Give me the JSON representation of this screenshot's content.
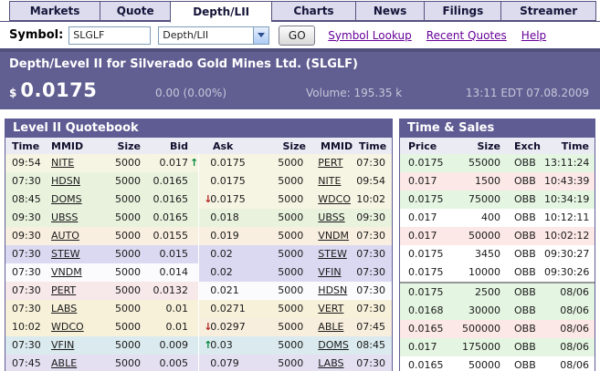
{
  "nav": {
    "tabs": [
      {
        "label": "Markets"
      },
      {
        "label": "Quote"
      },
      {
        "label": "Depth/LII"
      },
      {
        "label": "Charts"
      },
      {
        "label": "News"
      },
      {
        "label": "Filings"
      },
      {
        "label": "Streamer"
      }
    ],
    "active_tab": "Depth/LII"
  },
  "symbol_bar": {
    "label": "Symbol:",
    "symbol_value": "SLGLF",
    "view_selected": "Depth/LII",
    "go_label": "GO",
    "links": [
      {
        "label": "Symbol Lookup"
      },
      {
        "label": "Recent Quotes"
      },
      {
        "label": "Help"
      }
    ]
  },
  "quote_header": {
    "title": "Depth/Level II for Silverado Gold Mines Ltd.  (SLGLF)",
    "currency": "$",
    "price": "0.0175",
    "change": "0.00 (0.00%)",
    "volume": "Volume: 195.35 k",
    "timestamp": "13:11 EDT 07.08.2009"
  },
  "level2": {
    "title": "Level II Quotebook",
    "headers": [
      "Time",
      "MMID",
      "Size",
      "Bid",
      "Ask",
      "Size",
      "MMID",
      "Time"
    ],
    "rows": [
      {
        "bid_time": "09:54",
        "bid_mmid": "NITE",
        "bid_size": "5000",
        "bid": "0.017",
        "bid_arrow": "↑",
        "bid_arrow_color": "#00883c",
        "ask_arrow": "",
        "ask": "0.0175",
        "ask_size": "5000",
        "ask_mmid": "PERT",
        "ask_time": "07:30",
        "bid_bg": "#f6f4e2",
        "ask_bg": "#f6f4e2"
      },
      {
        "bid_time": "07:30",
        "bid_mmid": "HDSN",
        "bid_size": "5000",
        "bid": "0.0165",
        "bid_arrow": "",
        "ask_arrow": "",
        "ask": "0.0175",
        "ask_size": "5000",
        "ask_mmid": "NITE",
        "ask_time": "09:54",
        "bid_bg": "#e8f2dd",
        "ask_bg": "#f6f4e2"
      },
      {
        "bid_time": "08:45",
        "bid_mmid": "DOMS",
        "bid_size": "5000",
        "bid": "0.0165",
        "bid_arrow": "",
        "ask_arrow": "↓",
        "ask_arrow_color": "#b22222",
        "ask": "0.0175",
        "ask_size": "5000",
        "ask_mmid": "WDCO",
        "ask_time": "10:02",
        "bid_bg": "#e8f2dd",
        "ask_bg": "#f6f4e2"
      },
      {
        "bid_time": "09:30",
        "bid_mmid": "UBSS",
        "bid_size": "5000",
        "bid": "0.0165",
        "bid_arrow": "",
        "ask_arrow": "",
        "ask": "0.018",
        "ask_size": "5000",
        "ask_mmid": "UBSS",
        "ask_time": "09:30",
        "bid_bg": "#e8f2dd",
        "ask_bg": "#e8f2dd"
      },
      {
        "bid_time": "09:30",
        "bid_mmid": "AUTO",
        "bid_size": "5000",
        "bid": "0.0155",
        "bid_arrow": "",
        "ask_arrow": "",
        "ask": "0.019",
        "ask_size": "5000",
        "ask_mmid": "VNDM",
        "ask_time": "07:30",
        "bid_bg": "#f9efe0",
        "ask_bg": "#f9efe0"
      },
      {
        "bid_time": "07:30",
        "bid_mmid": "STEW",
        "bid_size": "5000",
        "bid": "0.015",
        "bid_arrow": "",
        "ask_arrow": "",
        "ask": "0.02",
        "ask_size": "5000",
        "ask_mmid": "STEW",
        "ask_time": "07:30",
        "bid_bg": "#dbd9f1",
        "ask_bg": "#dbd9f1"
      },
      {
        "bid_time": "07:30",
        "bid_mmid": "VNDM",
        "bid_size": "5000",
        "bid": "0.014",
        "bid_arrow": "",
        "ask_arrow": "",
        "ask": "0.02",
        "ask_size": "5000",
        "ask_mmid": "VFIN",
        "ask_time": "07:30",
        "bid_bg": "#fbfbfd",
        "ask_bg": "#dbd9f1"
      },
      {
        "bid_time": "07:30",
        "bid_mmid": "PERT",
        "bid_size": "5000",
        "bid": "0.0132",
        "bid_arrow": "",
        "ask_arrow": "",
        "ask": "0.021",
        "ask_size": "5000",
        "ask_mmid": "HDSN",
        "ask_time": "07:30",
        "bid_bg": "#f7e8e9",
        "ask_bg": "#fbfbfd"
      },
      {
        "bid_time": "07:30",
        "bid_mmid": "LABS",
        "bid_size": "5000",
        "bid": "0.01",
        "bid_arrow": "",
        "ask_arrow": "",
        "ask": "0.0271",
        "ask_size": "5000",
        "ask_mmid": "VERT",
        "ask_time": "07:30",
        "bid_bg": "#f7f1da",
        "ask_bg": "#f7f1da"
      },
      {
        "bid_time": "10:02",
        "bid_mmid": "WDCO",
        "bid_size": "5000",
        "bid": "0.01",
        "bid_arrow": "",
        "ask_arrow": "↓",
        "ask_arrow_color": "#b22222",
        "ask": "0.0297",
        "ask_size": "5000",
        "ask_mmid": "ABLE",
        "ask_time": "07:45",
        "bid_bg": "#f7f1da",
        "ask_bg": "#f8eedd"
      },
      {
        "bid_time": "07:30",
        "bid_mmid": "VFIN",
        "bid_size": "5000",
        "bid": "0.009",
        "bid_arrow": "",
        "ask_arrow": "↑",
        "ask_arrow_color": "#00883c",
        "ask": "0.03",
        "ask_size": "5000",
        "ask_mmid": "DOMS",
        "ask_time": "08:45",
        "bid_bg": "#dbeaee",
        "ask_bg": "#dbeaee"
      },
      {
        "bid_time": "07:45",
        "bid_mmid": "ABLE",
        "bid_size": "5000",
        "bid": "0.005",
        "bid_arrow": "",
        "ask_arrow": "",
        "ask": "0.079",
        "ask_size": "5000",
        "ask_mmid": "LABS",
        "ask_time": "07:30",
        "bid_bg": "#e4e0f2",
        "ask_bg": "#e4e0f2"
      }
    ]
  },
  "time_sales": {
    "title": "Time & Sales",
    "headers": [
      "Price",
      "Size",
      "Exch",
      "Time"
    ],
    "rows": [
      {
        "price": "0.0175",
        "size": "55000",
        "exch": "OBB",
        "time": "13:11:24",
        "bg": "#e4f5e2"
      },
      {
        "price": "0.017",
        "size": "1500",
        "exch": "OBB",
        "time": "10:43:39",
        "bg": "#fce8e6"
      },
      {
        "price": "0.0175",
        "size": "75000",
        "exch": "OBB",
        "time": "10:34:19",
        "bg": "#e4f5e2"
      },
      {
        "price": "0.017",
        "size": "400",
        "exch": "OBB",
        "time": "10:12:11",
        "bg": "#ffffff"
      },
      {
        "price": "0.017",
        "size": "50000",
        "exch": "OBB",
        "time": "10:02:12",
        "bg": "#fce8e6"
      },
      {
        "price": "0.0175",
        "size": "3450",
        "exch": "OBB",
        "time": "09:30:27",
        "bg": "#ffffff"
      },
      {
        "price": "0.0175",
        "size": "10000",
        "exch": "OBB",
        "time": "09:30:26",
        "bg": "#ffffff"
      },
      {
        "price": "0.0175",
        "size": "2500",
        "exch": "OBB",
        "time": "08/06",
        "bg": "#e4f5e2"
      },
      {
        "price": "0.0168",
        "size": "30000",
        "exch": "OBB",
        "time": "08/06",
        "bg": "#e4f5e2"
      },
      {
        "price": "0.0165",
        "size": "500000",
        "exch": "OBB",
        "time": "08/06",
        "bg": "#fce8e6"
      },
      {
        "price": "0.017",
        "size": "175000",
        "exch": "OBB",
        "time": "08/06",
        "bg": "#e4f5e2"
      },
      {
        "price": "0.0165",
        "size": "50000",
        "exch": "OBB",
        "time": "08/06",
        "bg": "#ffffff"
      }
    ]
  },
  "colors": {
    "accent_purple": "#5e5c93",
    "header_purple": "#615f92",
    "tab_bg": "#dcdcee",
    "tab_border": "#55527f",
    "link_purple": "#660099",
    "up_green": "#00883c",
    "down_red": "#b22222"
  }
}
